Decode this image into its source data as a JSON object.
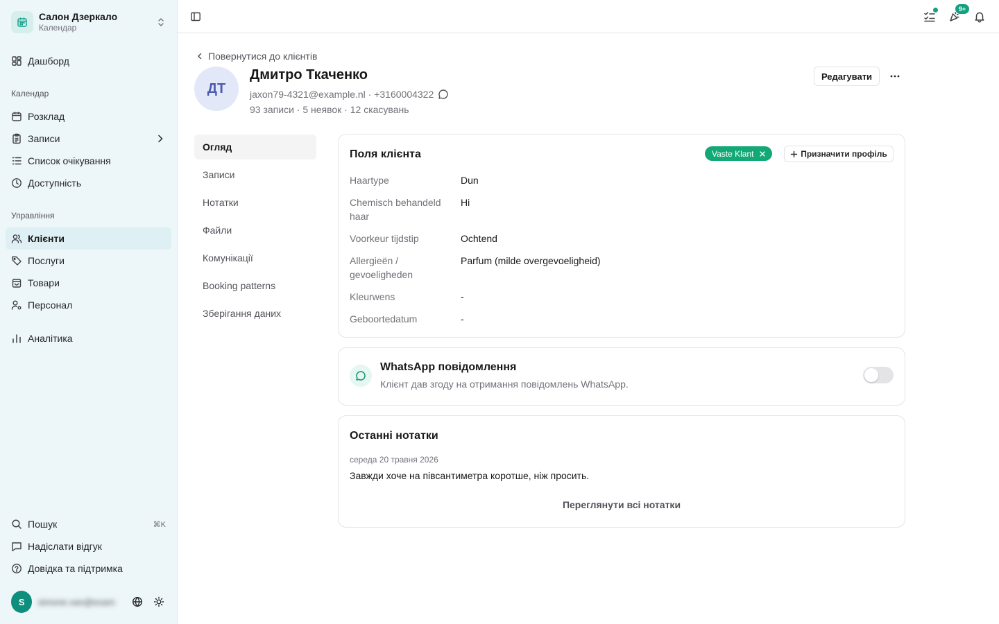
{
  "workspace": {
    "name": "Салон Дзеркало",
    "subtitle": "Календар"
  },
  "sidebar": {
    "dashboard": "Дашборд",
    "group_calendar": "Календар",
    "schedule": "Розклад",
    "appointments": "Записи",
    "waitlist": "Список очікування",
    "availability": "Доступність",
    "group_management": "Управління",
    "clients": "Клієнти",
    "services": "Послуги",
    "products": "Товари",
    "staff": "Персонал",
    "analytics": "Аналітика",
    "search": "Пошук",
    "search_shortcut": "⌘K",
    "feedback": "Надіслати відгук",
    "help": "Довідка та підтримка",
    "user_initial": "S",
    "user_email": "simone.van@example.nl"
  },
  "topbar": {
    "notification_badge": "9+"
  },
  "client": {
    "back_label": "Повернутися до клієнтів",
    "initials": "ДТ",
    "name": "Дмитро Ткаченко",
    "email": "jaxon79-4321@example.nl",
    "separator": " · ",
    "phone": "+3160004322",
    "stats": "93 записи · 5 неявок · 12 скасувань",
    "edit_label": "Редагувати"
  },
  "tabs": [
    "Огляд",
    "Записи",
    "Нотатки",
    "Файли",
    "Комунікації",
    "Booking patterns",
    "Зберігання даних"
  ],
  "fields_card": {
    "title": "Поля клієнта",
    "profile_tag": "Vaste Klant",
    "assign_label": "Призначити профіль",
    "rows": [
      {
        "label": "Haartype",
        "value": "Dun"
      },
      {
        "label": "Chemisch behandeld haar",
        "value": "Hi"
      },
      {
        "label": "Voorkeur tijdstip",
        "value": "Ochtend"
      },
      {
        "label": "Allergieën / gevoeligheden",
        "value": "Parfum (milde overgevoeligheid)"
      },
      {
        "label": "Kleurwens",
        "value": "-"
      },
      {
        "label": "Geboortedatum",
        "value": "-"
      }
    ]
  },
  "whatsapp_card": {
    "title": "WhatsApp повідомлення",
    "description": "Клієнт дав згоду на отримання повідомлень WhatsApp.",
    "enabled": false
  },
  "notes_card": {
    "title": "Останні нотатки",
    "date": "середа 20 травня 2026",
    "text": "Завжди хоче на півсантиметра коротше, ніж просить.",
    "view_all": "Переглянути всі нотатки"
  },
  "colors": {
    "accent": "#12a281",
    "tag": "#12a976",
    "sidebar_bg": "#edf6f8"
  }
}
